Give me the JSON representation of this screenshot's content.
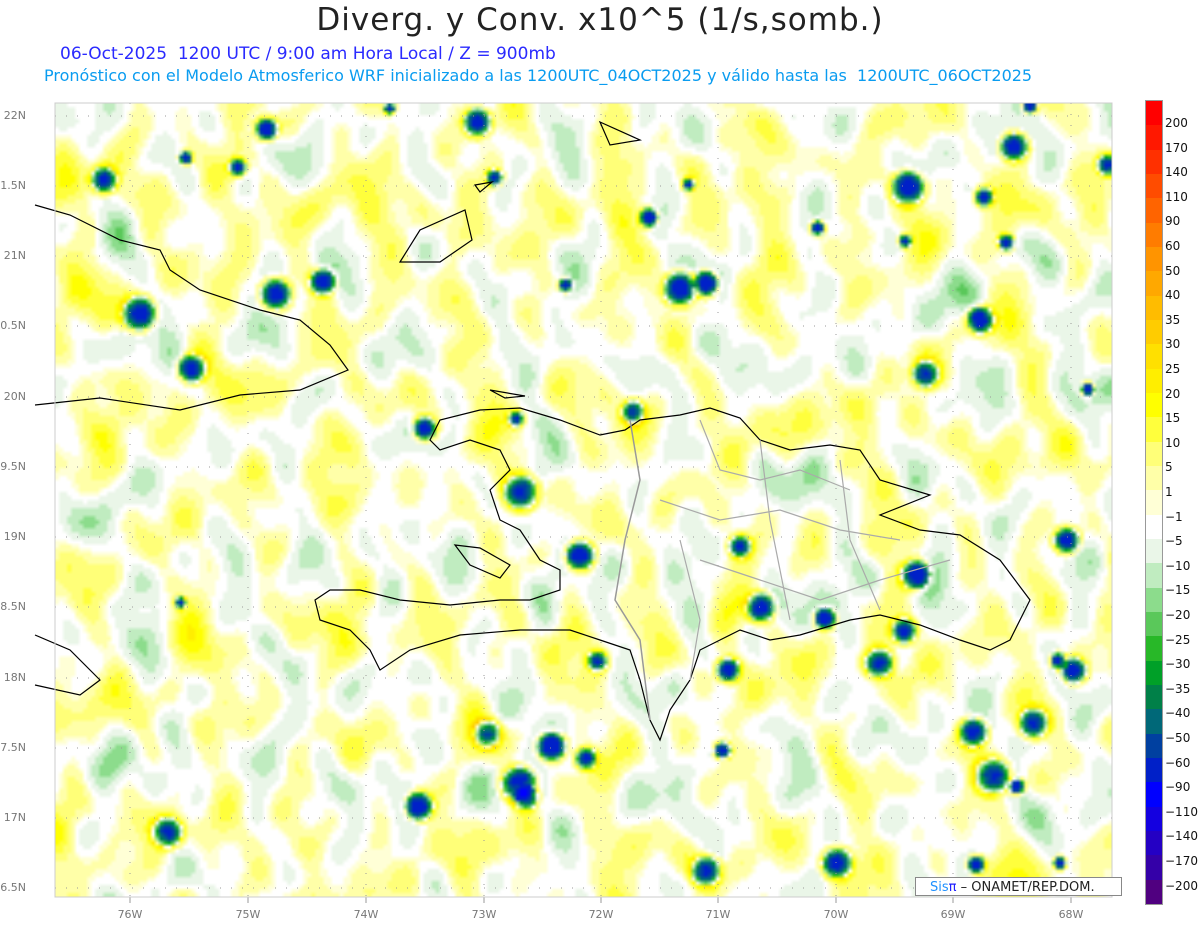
{
  "title": "Diverg. y Conv. x10^5 (1/s,somb.)",
  "subtitle_line1": "06-Oct-2025  1200 UTC / 9:00 am Hora Local / Z = 900mb",
  "subtitle_line2": "Pronóstico con el Modelo Atmosferico WRF inicializado a las 1200UTC_04OCT2025 y válido hasta las  1200UTC_06OCT2025",
  "lat_labels": [
    "22N",
    "1.5N",
    "21N",
    "0.5N",
    "20N",
    "9.5N",
    "19N",
    "8.5N",
    "18N",
    "7.5N",
    "17N",
    "6.5N"
  ],
  "lon_labels": [
    "76W",
    "75W",
    "74W",
    "73W",
    "72W",
    "71W",
    "70W",
    "69W",
    "68W"
  ],
  "colorbar": {
    "labels": [
      "200",
      "170",
      "140",
      "110",
      "90",
      "60",
      "50",
      "40",
      "35",
      "30",
      "25",
      "20",
      "15",
      "10",
      "5",
      "1",
      "−1",
      "−5",
      "−10",
      "−15",
      "−20",
      "−25",
      "−30",
      "−35",
      "−40",
      "−50",
      "−60",
      "−90",
      "−110",
      "−140",
      "−170",
      "−200"
    ],
    "colors": [
      "#ff0000",
      "#ff1800",
      "#ff3000",
      "#ff4c00",
      "#ff6400",
      "#ff7c00",
      "#ff9400",
      "#ffa800",
      "#ffbc00",
      "#ffcc00",
      "#ffe000",
      "#ffee00",
      "#ffff00",
      "#ffff3c",
      "#ffff78",
      "#ffffa8",
      "#ffffd6",
      "#ffffff",
      "#eaf6e8",
      "#c0ecc0",
      "#8cdc8c",
      "#5ac85a",
      "#28b828",
      "#00a028",
      "#008048",
      "#006878",
      "#0040a0",
      "#0020c8",
      "#0000ff",
      "#1400e0",
      "#2400c4",
      "#3400a8",
      "#500080"
    ]
  },
  "credit": {
    "sis": "Sis",
    "pi": "π",
    "rest": " – ONAMET/REP.DOM."
  }
}
